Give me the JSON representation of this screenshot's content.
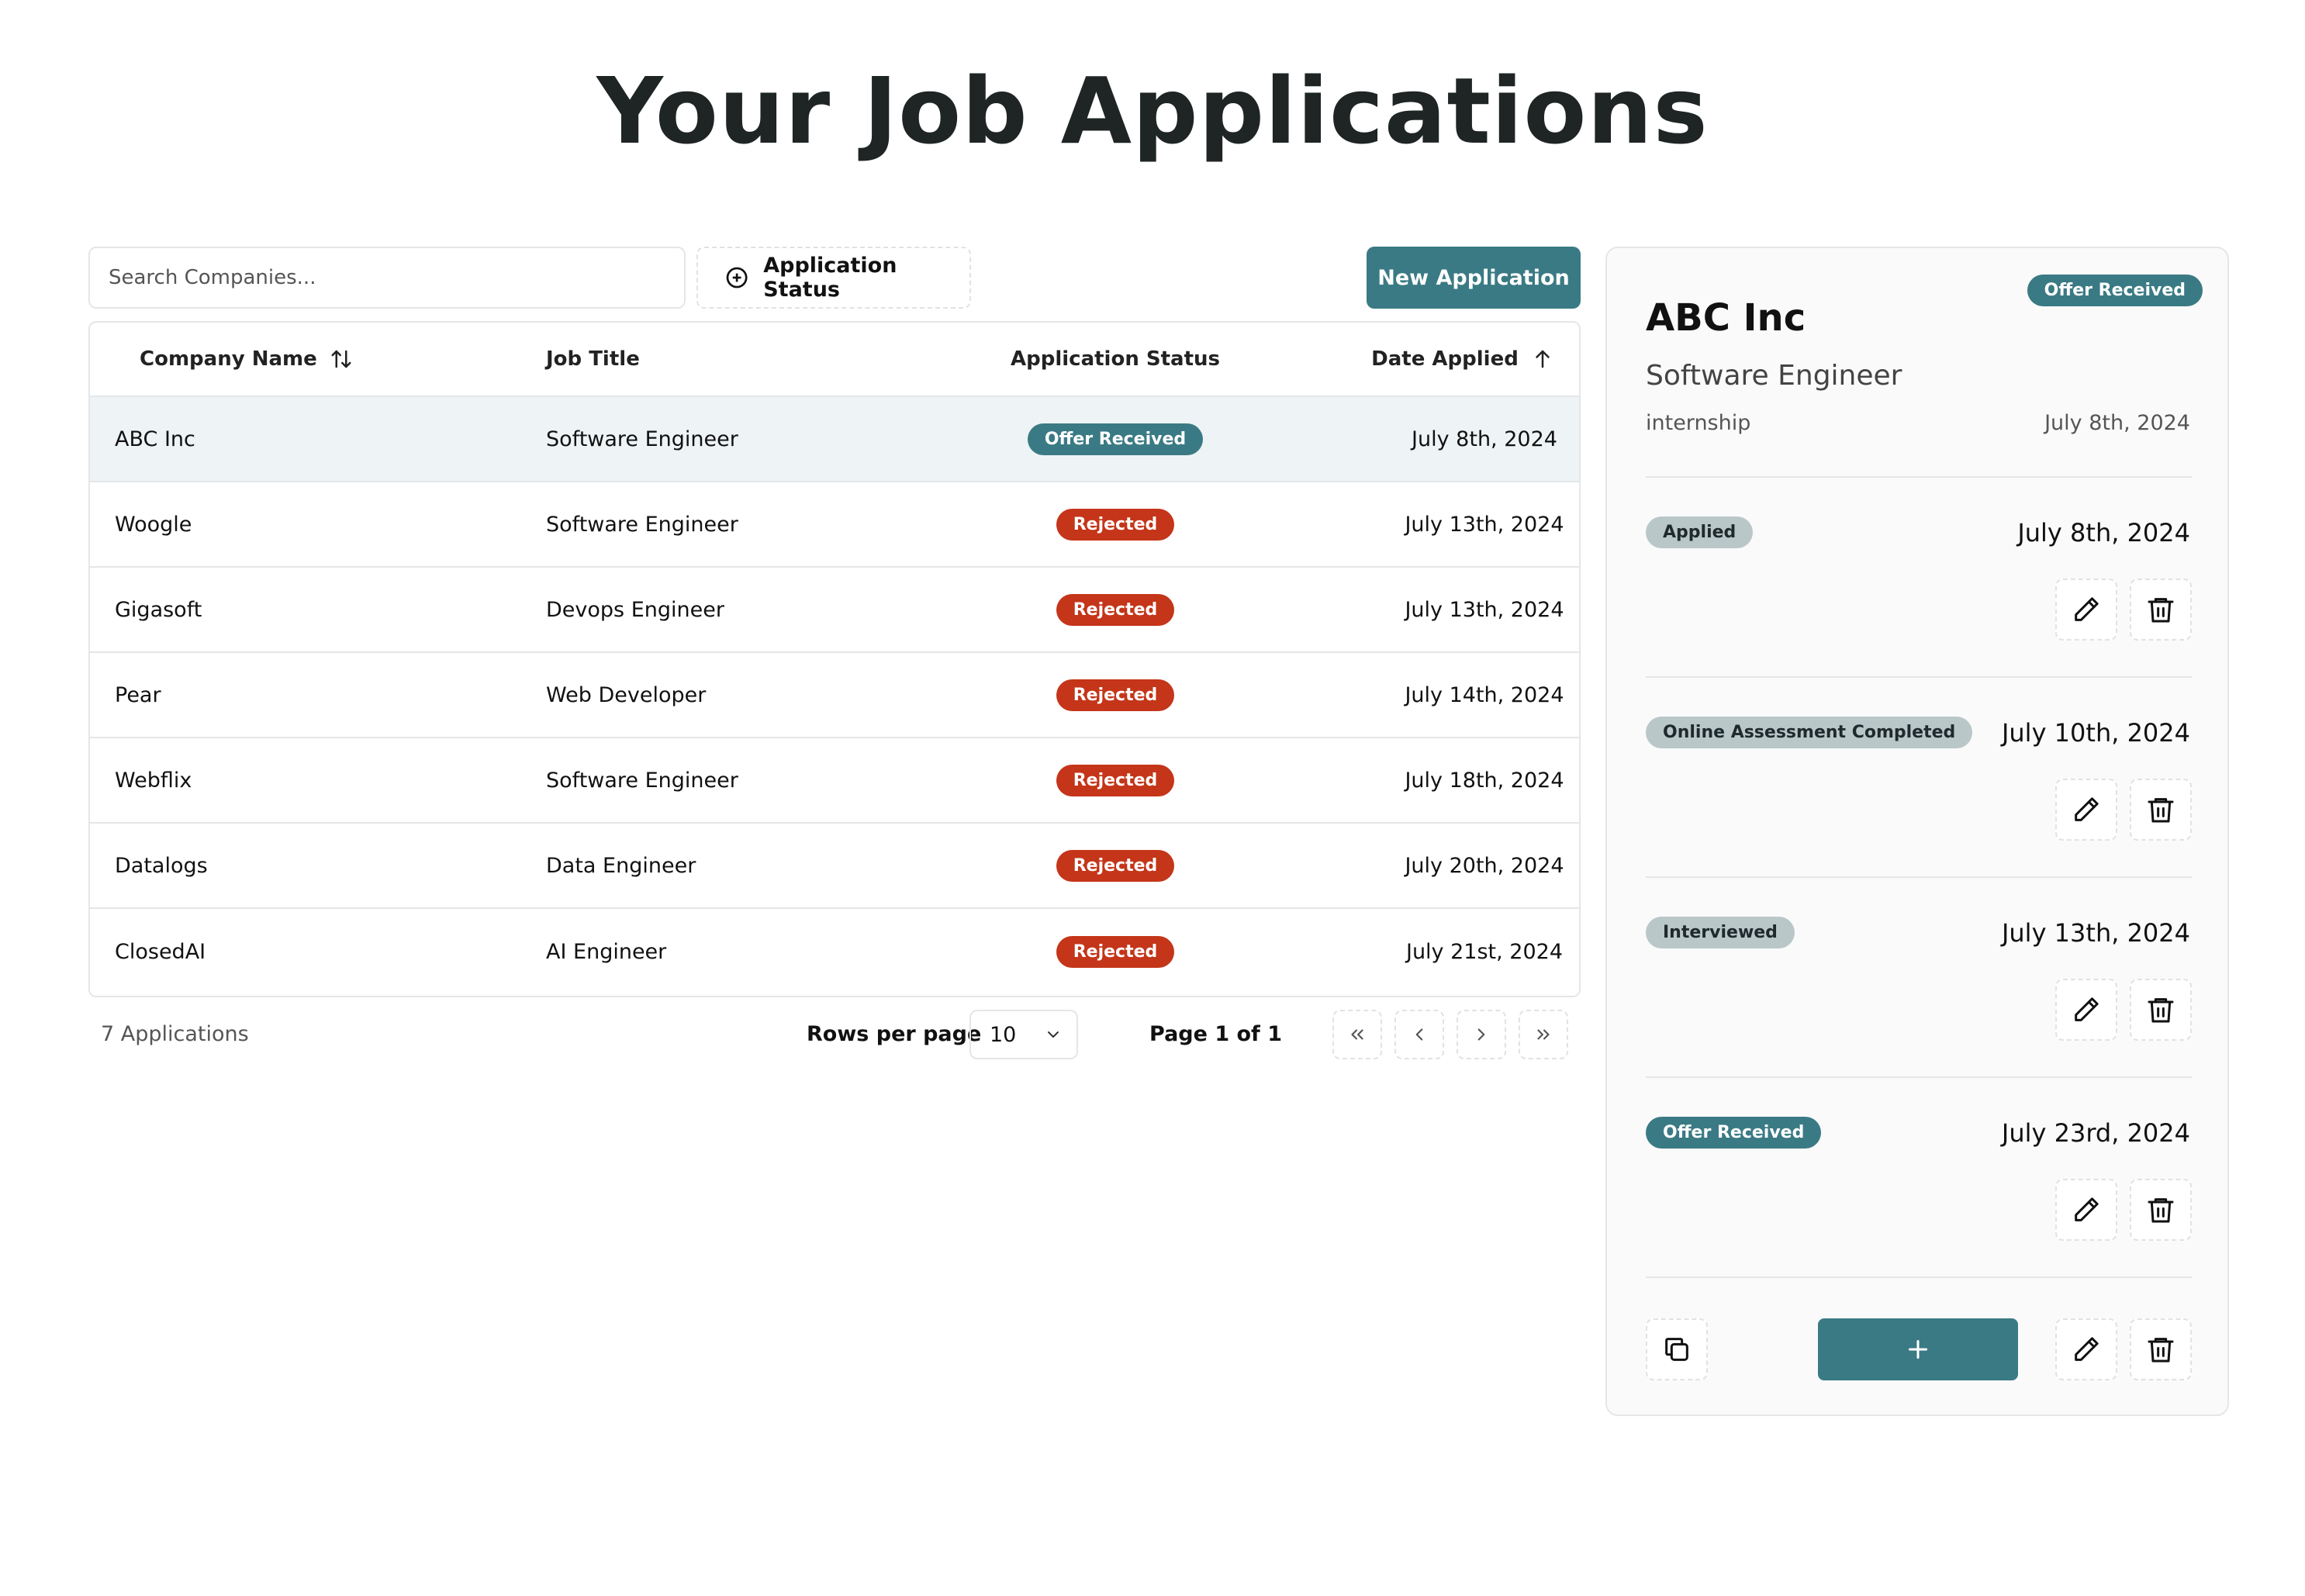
{
  "page": {
    "title": "Your Job Applications"
  },
  "toolbar": {
    "search_placeholder": "Search Companies...",
    "status_filter_label": "Application Status",
    "new_application_label": "New Application"
  },
  "table": {
    "columns": [
      "Company Name",
      "Job Title",
      "Application Status",
      "Date Applied"
    ],
    "rows": [
      {
        "company": "ABC Inc",
        "title": "Software Engineer",
        "status": "Offer Received",
        "date": "July 8th, 2024"
      },
      {
        "company": "Woogle",
        "title": "Software Engineer",
        "status": "Rejected",
        "date": "July 13th, 2024"
      },
      {
        "company": "Gigasoft",
        "title": "Devops Engineer",
        "status": "Rejected",
        "date": "July 13th, 2024"
      },
      {
        "company": "Pear",
        "title": "Web Developer",
        "status": "Rejected",
        "date": "July 14th, 2024"
      },
      {
        "company": "Webflix",
        "title": "Software Engineer",
        "status": "Rejected",
        "date": "July 18th, 2024"
      },
      {
        "company": "Datalogs",
        "title": "Data Engineer",
        "status": "Rejected",
        "date": "July 20th, 2024"
      },
      {
        "company": "ClosedAI",
        "title": "AI Engineer",
        "status": "Rejected",
        "date": "July 21st, 2024"
      }
    ]
  },
  "pagination": {
    "count_label": "7 Applications",
    "rows_per_page_label": "Rows per page",
    "rows_per_page_value": "10",
    "page_label": "Page 1 of 1"
  },
  "detail": {
    "status": "Offer Received",
    "company": "ABC Inc",
    "job_title": "Software Engineer",
    "job_type": "internship",
    "date": "July 8th, 2024",
    "events": [
      {
        "status": "Applied",
        "date": "July 8th, 2024"
      },
      {
        "status": "Online Assessment Completed",
        "date": "July 10th, 2024"
      },
      {
        "status": "Interviewed",
        "date": "July 13th, 2024"
      },
      {
        "status": "Offer Received",
        "date": "July 23rd, 2024"
      }
    ]
  },
  "colors": {
    "accent": "#3a7a84",
    "rejected": "#c43519",
    "neutral_badge": "#b9c7c9",
    "selected_row": "#eef3f5"
  },
  "icons": {
    "sort": "sort-arrows-icon",
    "sort_asc": "arrow-up-icon",
    "filter": "plus-circle-icon",
    "edit": "pencil-icon",
    "delete": "trash-icon",
    "copy": "copy-icon",
    "add": "plus-icon"
  }
}
